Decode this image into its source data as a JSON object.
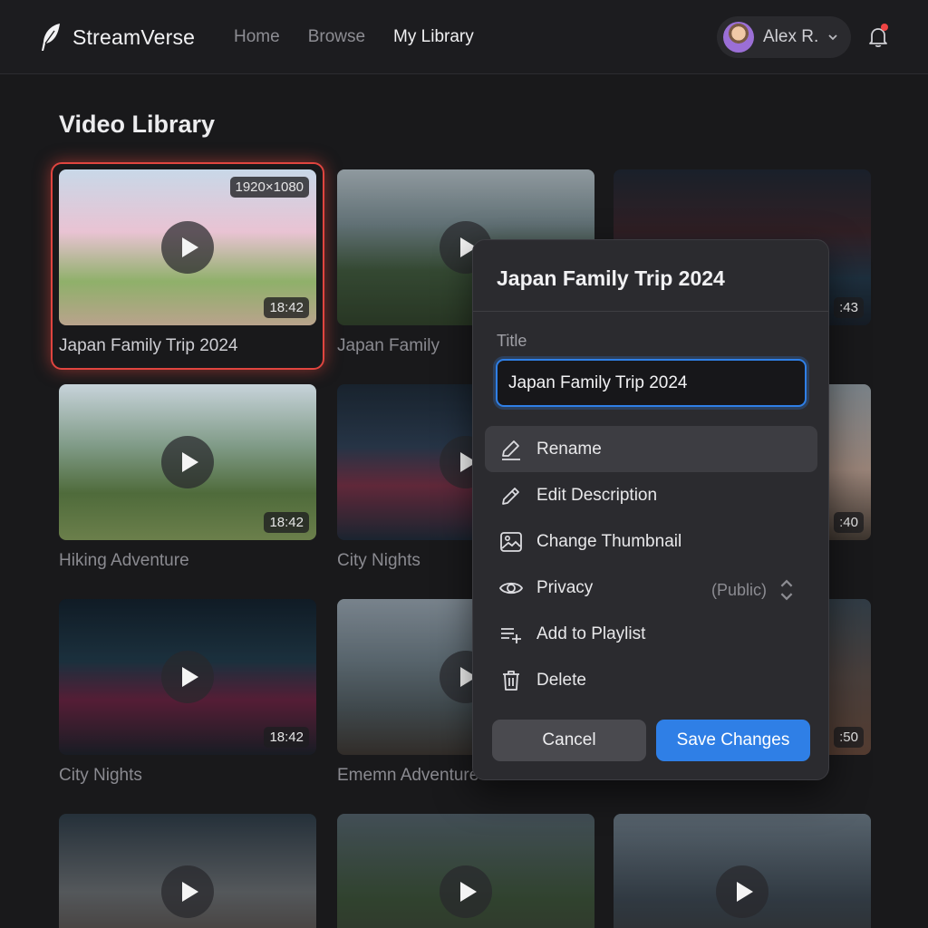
{
  "app": {
    "name": "StreamVerse"
  },
  "nav": {
    "items": [
      "Home",
      "Browse",
      "My Library"
    ],
    "active_index": 2
  },
  "user": {
    "name": "Alex R.",
    "has_notifications": true
  },
  "page": {
    "title": "Video Library"
  },
  "videos": [
    {
      "title": "Japan Family Trip 2024",
      "duration": "18:42",
      "resolution": "1920×1080",
      "selected": true
    },
    {
      "title": "Japan Family",
      "duration": ""
    },
    {
      "title": "",
      "duration": ":43"
    },
    {
      "title": "Hiking Adventure",
      "duration": "18:42"
    },
    {
      "title": "City Nights",
      "duration": ""
    },
    {
      "title": "",
      "duration": ":40"
    },
    {
      "title": "City Nights",
      "duration": "18:42"
    },
    {
      "title": "Ememn Adventure",
      "duration": ""
    },
    {
      "title": "",
      "duration": ":50"
    },
    {
      "title": "",
      "duration": ""
    },
    {
      "title": "",
      "duration": ""
    },
    {
      "title": "",
      "duration": ""
    }
  ],
  "dialog": {
    "title": "Japan Family Trip 2024",
    "field_label": "Title",
    "field_value": "Japan Family Trip 2024",
    "menu": [
      {
        "label": "Rename",
        "icon": "pen-icon",
        "highlighted": true
      },
      {
        "label": "Edit Description",
        "icon": "pencil-icon"
      },
      {
        "label": "Change Thumbnail",
        "icon": "image-icon"
      },
      {
        "label": "Privacy",
        "icon": "eye-icon",
        "value": "(Public)"
      },
      {
        "label": "Add to Playlist",
        "icon": "playlist-add-icon"
      },
      {
        "label": "Delete",
        "icon": "trash-icon"
      }
    ],
    "cancel_label": "Cancel",
    "save_label": "Save Changes"
  },
  "colors": {
    "accent": "#2f7fe6",
    "selection": "#e0453f",
    "notification": "#ef4444"
  }
}
